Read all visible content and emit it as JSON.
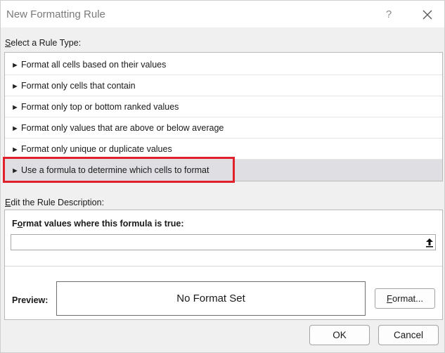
{
  "dialog": {
    "title": "New Formatting Rule",
    "help_label": "?"
  },
  "rule_type": {
    "label_accel": "S",
    "label_rest": "elect a Rule Type:",
    "items": [
      {
        "label": "Format all cells based on their values"
      },
      {
        "label": "Format only cells that contain"
      },
      {
        "label": "Format only top or bottom ranked values"
      },
      {
        "label": "Format only values that are above or below average"
      },
      {
        "label": "Format only unique or duplicate values"
      },
      {
        "label": "Use a formula to determine which cells to format",
        "selected": true
      }
    ],
    "bullet_glyph": "►"
  },
  "description": {
    "label_accel": "E",
    "label_rest": "dit the Rule Description:",
    "formula_label_accel": "o",
    "formula_label_pre": "F",
    "formula_label_rest": "rmat values where this formula is true:",
    "formula_value": "",
    "preview_label": "Preview:",
    "preview_text": "No Format Set",
    "format_button_accel": "F",
    "format_button_rest": "ormat..."
  },
  "buttons": {
    "ok": "OK",
    "cancel": "Cancel"
  },
  "colors": {
    "highlight": "#e0202a",
    "selected_row": "#dedee3"
  }
}
